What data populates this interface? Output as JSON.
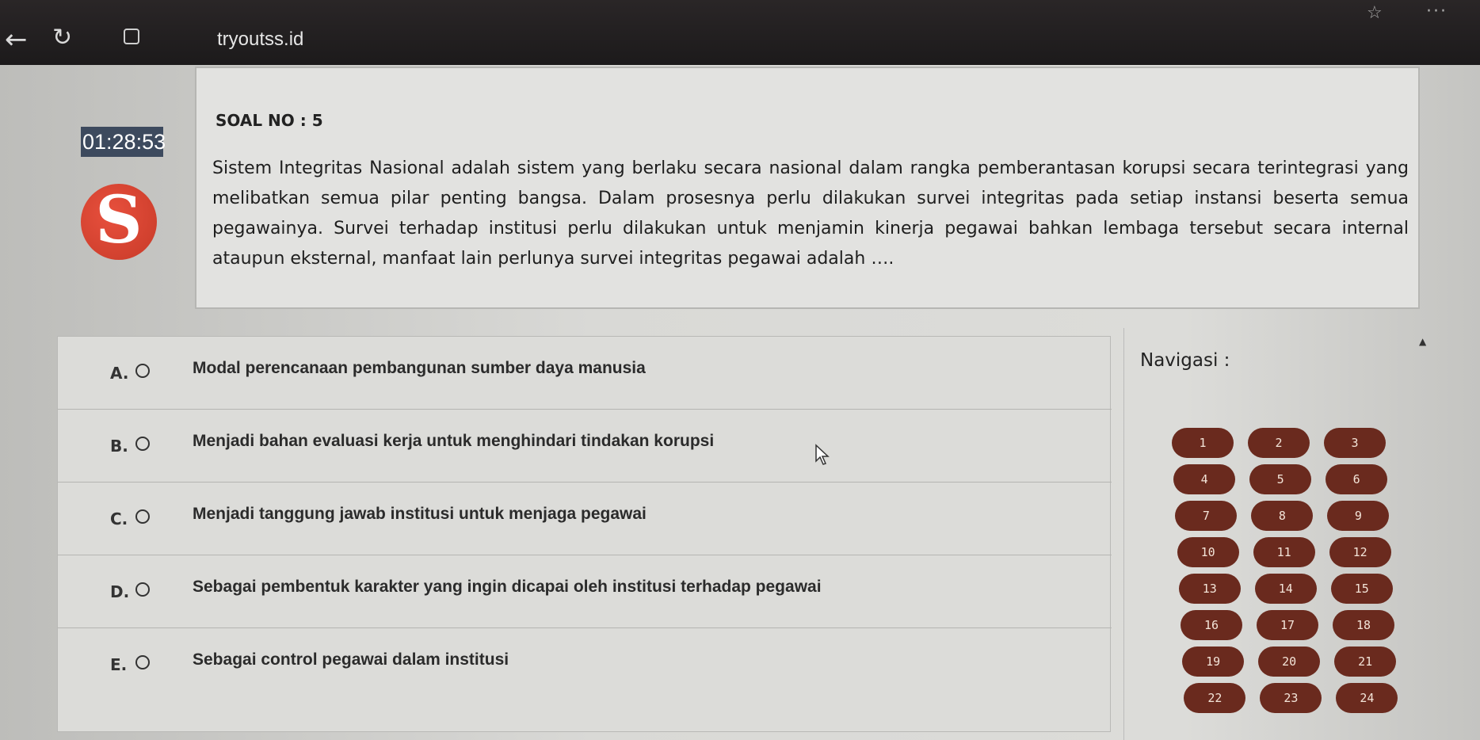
{
  "browser": {
    "url": "tryoutss.id"
  },
  "timer": "01:28:53",
  "question": {
    "label": "SOAL NO :",
    "number": "5",
    "text": "Sistem Integritas Nasional adalah sistem yang berlaku secara nasional dalam rangka pemberantasan korupsi secara terintegrasi yang melibatkan semua pilar penting bangsa. Dalam prosesnya perlu dilakukan survei integritas pada setiap instansi beserta semua pegawainya. Survei terhadap institusi perlu dilakukan untuk menjamin kinerja pegawai bahkan lembaga tersebut secara internal ataupun eksternal, manfaat lain perlunya survei integritas pegawai adalah …."
  },
  "options": [
    {
      "letter": "A.",
      "text": "Modal perencanaan pembangunan sumber daya manusia"
    },
    {
      "letter": "B.",
      "text": "Menjadi bahan evaluasi kerja untuk menghindari tindakan korupsi"
    },
    {
      "letter": "C.",
      "text": "Menjadi tanggung jawab institusi untuk menjaga pegawai"
    },
    {
      "letter": "D.",
      "text": "Sebagai pembentuk karakter yang ingin dicapai oleh institusi terhadap pegawai"
    },
    {
      "letter": "E.",
      "text": "Sebagai control pegawai dalam institusi"
    }
  ],
  "navigation": {
    "title": "Navigasi :",
    "buttons": [
      "1",
      "2",
      "3",
      "4",
      "5",
      "6",
      "7",
      "8",
      "9",
      "10",
      "11",
      "12",
      "13",
      "14",
      "15",
      "16",
      "17",
      "18",
      "19",
      "20",
      "21",
      "22",
      "23",
      "24"
    ]
  },
  "colors": {
    "nav_button": "#6a2a1e",
    "timer_bg": "#3d4a5e",
    "logo": "#d8432f"
  }
}
